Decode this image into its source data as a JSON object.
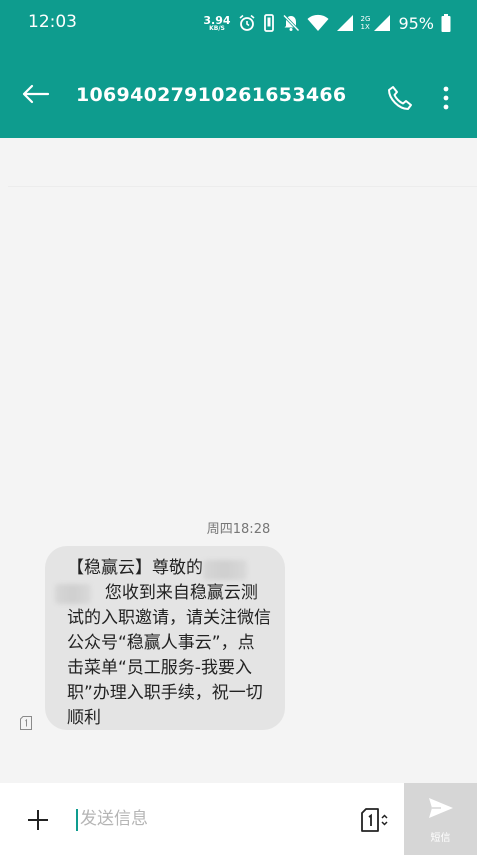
{
  "status_bar": {
    "time": "12:03",
    "net_speed_value": "3.94",
    "net_speed_unit": "KB/S",
    "signal_2g": "2G",
    "signal_1x": "1X",
    "battery_percent": "95%",
    "icons": [
      "alarm-icon",
      "vibrate-icon",
      "mute-icon",
      "wifi-icon",
      "signal-icon",
      "battery-icon"
    ]
  },
  "app_bar": {
    "title": "10694027910261653466",
    "icons": [
      "back-arrow-icon",
      "phone-icon",
      "more-vert-icon"
    ],
    "color": "#0e9c8e"
  },
  "conversation": {
    "timestamp": "周四18:28",
    "messages": [
      {
        "direction": "incoming",
        "text": "【稳赢云】尊敬的\n       您收到来自稳赢云测试的入职邀请，请关注微信公众号“稳赢人事云”，点击菜单“员工服务-我要入职”办理入职手续，祝一切顺利",
        "sim_icon": "sim-1-icon"
      }
    ]
  },
  "composer": {
    "placeholder": "发送信息",
    "value": "",
    "send_label": "短信",
    "icons": [
      "plus-icon",
      "sim-switch-icon",
      "send-icon"
    ]
  }
}
